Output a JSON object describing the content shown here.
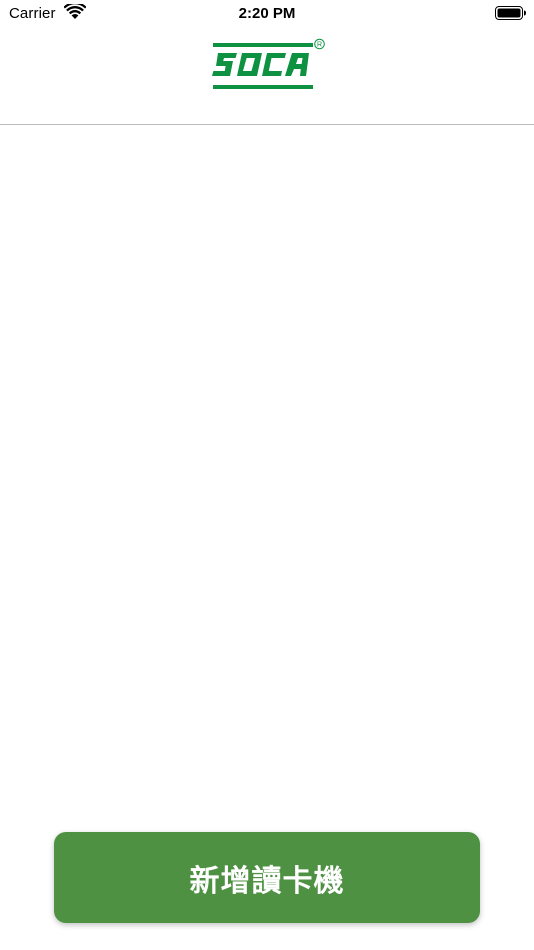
{
  "status_bar": {
    "carrier": "Carrier",
    "time": "2:20 PM",
    "wifi_icon": "wifi-icon",
    "battery_icon": "battery-full-icon"
  },
  "header": {
    "logo_text": "SOCA",
    "logo_mark": "®",
    "logo_color": "#0f9142"
  },
  "main": {
    "add_button_label": "新增讀卡機",
    "add_button_color": "#4e9142"
  }
}
